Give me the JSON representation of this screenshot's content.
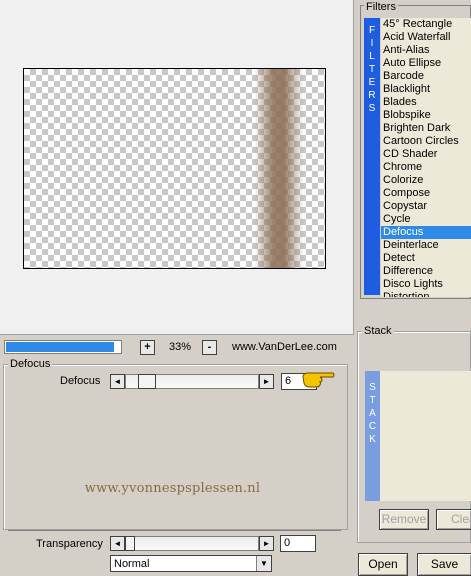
{
  "preview": {
    "zoom_minus": "-",
    "zoom_plus": "+",
    "zoom_value": "33%",
    "progress_fraction": 0.95,
    "site": "www.VanDerLee.com"
  },
  "filters": {
    "group_label": "Filters",
    "tab_text": [
      "F",
      "I",
      "L",
      "T",
      "E",
      "R",
      "S"
    ],
    "items": [
      "45° Rectangle",
      "Acid Waterfall",
      "Anti-Alias",
      "Auto Ellipse",
      "Barcode",
      "Blacklight",
      "Blades",
      "Blobspike",
      "Brighten Dark",
      "Cartoon Circles",
      "CD Shader",
      "Chrome",
      "Colorize",
      "Compose",
      "Copystar",
      "Cycle",
      "Defocus",
      "Deinterlace",
      "Detect",
      "Difference",
      "Disco Lights",
      "Distortion"
    ],
    "selected": "Defocus"
  },
  "defocus": {
    "group_label": "Defocus",
    "slider_label": "Defocus",
    "slider_value": "6",
    "left_arrow": "◄",
    "right_arrow": "►"
  },
  "watermark": "www.yvonnespsplessen.nl",
  "transparency": {
    "label": "Transparency",
    "value": "0",
    "left_arrow": "◄",
    "right_arrow": "►"
  },
  "blend": {
    "selected": "Normal",
    "arrow": "▼"
  },
  "stack": {
    "group_label": "Stack",
    "tab_text": [
      "S",
      "T",
      "A",
      "C",
      "K"
    ],
    "remove_label": "Remove",
    "clear_label": "Clea"
  },
  "actions": {
    "open_label": "Open",
    "save_label": "Save"
  }
}
